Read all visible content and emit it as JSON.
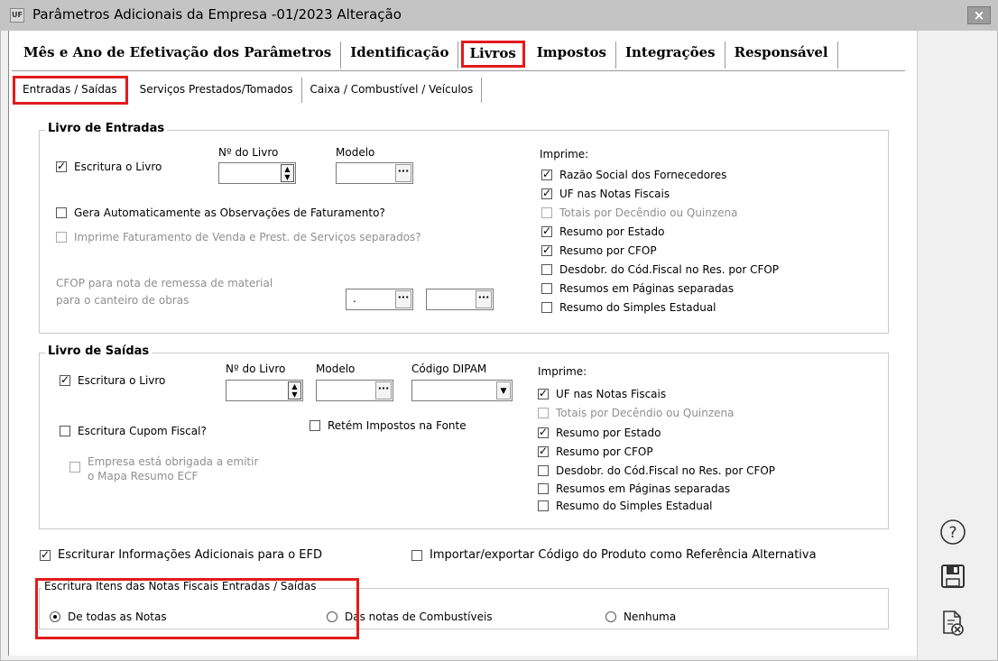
{
  "window": {
    "title": "Parâmetros Adicionais da Empresa -01/2023 Alteração",
    "app_icon_text": "UF",
    "close_glyph": "×"
  },
  "main_tabs": [
    {
      "label": "Mês e Ano de Efetivação dos Parâmetros",
      "active": false
    },
    {
      "label": "Identificação",
      "active": false
    },
    {
      "label": "Livros",
      "active": true
    },
    {
      "label": "Impostos",
      "active": false
    },
    {
      "label": "Integrações",
      "active": false
    },
    {
      "label": "Responsável",
      "active": false
    }
  ],
  "sub_tabs": [
    {
      "label": "Entradas / Saídas",
      "active": true
    },
    {
      "label": "Serviços Prestados/Tomados",
      "active": false
    },
    {
      "label": "Caixa / Combustível / Veículos",
      "active": false
    }
  ],
  "entradas": {
    "title": "Livro de Entradas",
    "escritura": {
      "label": "Escritura o Livro",
      "checked": true
    },
    "num_livro_label": "Nº do Livro",
    "num_livro_value": "",
    "modelo_label": "Modelo",
    "modelo_value": "",
    "gera_obs": {
      "label": "Gera Automaticamente as Observações de Faturamento?",
      "checked": false
    },
    "imprime_fat": {
      "label": "Imprime Faturamento de Venda e Prest. de Serviços separados?",
      "checked": false,
      "disabled": true
    },
    "cfop_label_1": "CFOP para nota de remessa de material",
    "cfop_label_2": "para o canteiro de obras",
    "cfop_value_1": ".",
    "cfop_value_2": "",
    "imprime_label": "Imprime:",
    "imprime": [
      {
        "label": "Razão Social dos Fornecedores",
        "checked": true,
        "disabled": false
      },
      {
        "label": "UF nas Notas Fiscais",
        "checked": true,
        "disabled": false
      },
      {
        "label": "Totais por Decêndio ou Quinzena",
        "checked": false,
        "disabled": true
      },
      {
        "label": "Resumo por Estado",
        "checked": true,
        "disabled": false
      },
      {
        "label": "Resumo por CFOP",
        "checked": true,
        "disabled": false
      },
      {
        "label": "Desdobr. do Cód.Fiscal no Res. por CFOP",
        "checked": false,
        "disabled": false
      },
      {
        "label": "Resumos em Páginas separadas",
        "checked": false,
        "disabled": false
      },
      {
        "label": "Resumo do Simples Estadual",
        "checked": false,
        "disabled": false
      }
    ]
  },
  "saidas": {
    "title": "Livro de Saídas",
    "escritura": {
      "label": "Escritura o Livro",
      "checked": true
    },
    "num_livro_label": "Nº do Livro",
    "modelo_label": "Modelo",
    "dipam_label": "Código DIPAM",
    "cupom": {
      "label": "Escritura Cupom Fiscal?",
      "checked": false
    },
    "retem": {
      "label": "Retém Impostos na Fonte",
      "checked": false
    },
    "mapa_1": "Empresa está obrigada a emitir",
    "mapa_2": "o Mapa Resumo ECF",
    "imprime_label": "Imprime:",
    "imprime": [
      {
        "label": "UF nas Notas Fiscais",
        "checked": true,
        "disabled": false
      },
      {
        "label": "Totais por Decêndio ou Quinzena",
        "checked": false,
        "disabled": true
      },
      {
        "label": "Resumo por Estado",
        "checked": true,
        "disabled": false
      },
      {
        "label": "Resumo por CFOP",
        "checked": true,
        "disabled": false
      },
      {
        "label": "Desdobr. do Cód.Fiscal no Res. por CFOP",
        "checked": false,
        "disabled": false
      },
      {
        "label": "Resumos em Páginas separadas",
        "checked": false,
        "disabled": false
      },
      {
        "label": "Resumo do Simples Estadual",
        "checked": false,
        "disabled": false
      }
    ]
  },
  "efd": {
    "label": "Escriturar Informações Adicionais para o EFD",
    "checked": true
  },
  "importar": {
    "label": "Importar/exportar Código do Produto como Referência Alternativa",
    "checked": false
  },
  "itens": {
    "title": "Escritura Itens das Notas Fiscais Entradas / Saídas",
    "options": [
      {
        "label": "De todas as Notas",
        "selected": true
      },
      {
        "label": "Das notas de Combustíveis",
        "selected": false
      },
      {
        "label": "Nenhuma",
        "selected": false
      }
    ]
  }
}
